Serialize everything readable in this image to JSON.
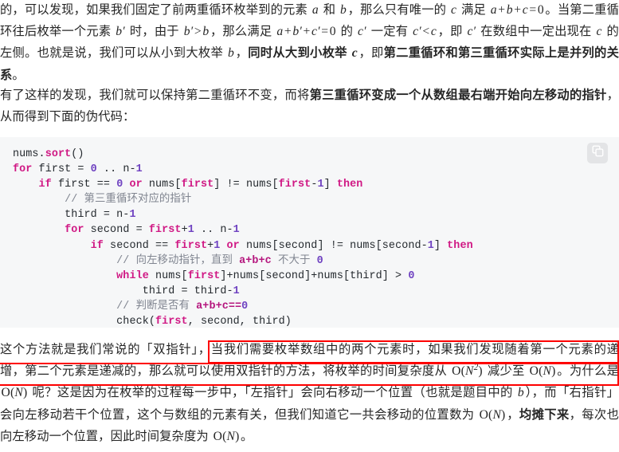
{
  "document": {
    "language": "zh-CN",
    "paragraph_1": {
      "text_runs": [
        {
          "type": "text",
          "value": "的，可以发现，如果我们固定了前两重循环枚举到的元素 "
        },
        {
          "type": "math",
          "value": "a"
        },
        {
          "type": "text",
          "value": " 和 "
        },
        {
          "type": "math",
          "value": "b"
        },
        {
          "type": "text",
          "value": "，那么只有唯一的 "
        },
        {
          "type": "math",
          "value": "c"
        },
        {
          "type": "text",
          "value": " 满足 "
        },
        {
          "type": "math",
          "value": "a + b + c = 0"
        },
        {
          "type": "text",
          "value": "。当第二重循环往后枚举一个元素 "
        },
        {
          "type": "math",
          "value": "b′"
        },
        {
          "type": "text",
          "value": " 时，由于 "
        },
        {
          "type": "math",
          "value": "b′ > b"
        },
        {
          "type": "text",
          "value": "，那么满足 "
        },
        {
          "type": "math",
          "value": "a + b′ + c′ = 0"
        },
        {
          "type": "text",
          "value": " 的 "
        },
        {
          "type": "math",
          "value": "c′"
        },
        {
          "type": "text",
          "value": " 一定有 "
        },
        {
          "type": "math",
          "value": "c′ < c"
        },
        {
          "type": "text",
          "value": "，即 "
        },
        {
          "type": "math",
          "value": "c′"
        },
        {
          "type": "text",
          "value": " 在数组中一定出现在 "
        },
        {
          "type": "math",
          "value": "c"
        },
        {
          "type": "text",
          "value": " 的左侧。也就是说，我们可以从小到大枚举 "
        },
        {
          "type": "math",
          "value": "b"
        },
        {
          "type": "text",
          "value": "，"
        },
        {
          "type": "bold",
          "value": "同时从大到小枚举 "
        },
        {
          "type": "bold-math",
          "value": "c"
        },
        {
          "type": "text",
          "value": "，即"
        },
        {
          "type": "bold",
          "value": "第二重循环和第三重循环实际上是并列的关系"
        },
        {
          "type": "text",
          "value": "。"
        }
      ]
    },
    "paragraph_2": {
      "text_runs": [
        {
          "type": "text",
          "value": "有了这样的发现，我们就可以保持第二重循环不变，而将"
        },
        {
          "type": "bold",
          "value": "第三重循环变成一个从数组最右端开始向左移动的指针"
        },
        {
          "type": "text",
          "value": "，从而得到下面的伪代码："
        }
      ]
    },
    "paragraph_3": {
      "text_runs": [
        {
          "type": "text",
          "value": "这个方法就是我们常说的「双指针」，当我们需要枚举数组中的两个元素时，如果我们发现随着第一个元素的递增，第二个元素是递减的，那么就可以使用双指针的方法，将枚举的时间复杂度从 "
        },
        {
          "type": "math",
          "value": "O(N²)"
        },
        {
          "type": "text",
          "value": " 减少至 "
        },
        {
          "type": "math",
          "value": "O(N)"
        },
        {
          "type": "text",
          "value": "。为什么是 "
        },
        {
          "type": "math",
          "value": "O(N)"
        },
        {
          "type": "text",
          "value": " 呢？这是因为在枚举的过程每一步中，「左指针」会向右移动一个位置（也就是题目中的 "
        },
        {
          "type": "math",
          "value": "b"
        },
        {
          "type": "text",
          "value": "），而「右指针」会向左移动若干个位置，这个与数组的元素有关，但我们知道它一共会移动的位置数为 "
        },
        {
          "type": "math",
          "value": "O(N)"
        },
        {
          "type": "text",
          "value": "，"
        },
        {
          "type": "bold",
          "value": "均摊下来"
        },
        {
          "type": "text",
          "value": "，每次也向左移动一个位置，因此时间复杂度为 "
        },
        {
          "type": "math",
          "value": "O(N)"
        },
        {
          "type": "text",
          "value": "。"
        }
      ]
    }
  },
  "code_block": {
    "language": "pseudocode",
    "copy_button": {
      "icon": "copy-icon",
      "label": ""
    },
    "lines": [
      [
        {
          "t": "pl",
          "v": "nums."
        },
        {
          "t": "id",
          "v": "sort"
        },
        {
          "t": "pl",
          "v": "()"
        }
      ],
      [
        {
          "t": "kw",
          "v": "for"
        },
        {
          "t": "pl",
          "v": " first = "
        },
        {
          "t": "num",
          "v": "0"
        },
        {
          "t": "pl",
          "v": " .. n-"
        },
        {
          "t": "num",
          "v": "1"
        }
      ],
      [
        {
          "t": "pl",
          "v": "    "
        },
        {
          "t": "kw",
          "v": "if"
        },
        {
          "t": "pl",
          "v": " first == "
        },
        {
          "t": "num",
          "v": "0"
        },
        {
          "t": "pl",
          "v": " "
        },
        {
          "t": "kw",
          "v": "or"
        },
        {
          "t": "pl",
          "v": " nums["
        },
        {
          "t": "id",
          "v": "first"
        },
        {
          "t": "pl",
          "v": "] != nums["
        },
        {
          "t": "id",
          "v": "first"
        },
        {
          "t": "pl",
          "v": "-"
        },
        {
          "t": "num",
          "v": "1"
        },
        {
          "t": "pl",
          "v": "] "
        },
        {
          "t": "kw",
          "v": "then"
        }
      ],
      [
        {
          "t": "pl",
          "v": "        "
        },
        {
          "t": "cmt",
          "v": "// 第三重循环对应的指针"
        }
      ],
      [
        {
          "t": "pl",
          "v": "        third = n-"
        },
        {
          "t": "num",
          "v": "1"
        }
      ],
      [
        {
          "t": "pl",
          "v": "        "
        },
        {
          "t": "kw",
          "v": "for"
        },
        {
          "t": "pl",
          "v": " second = "
        },
        {
          "t": "id",
          "v": "first"
        },
        {
          "t": "pl",
          "v": "+"
        },
        {
          "t": "num",
          "v": "1"
        },
        {
          "t": "pl",
          "v": " .. n-"
        },
        {
          "t": "num",
          "v": "1"
        }
      ],
      [
        {
          "t": "pl",
          "v": "            "
        },
        {
          "t": "kw",
          "v": "if"
        },
        {
          "t": "pl",
          "v": " second == "
        },
        {
          "t": "id",
          "v": "first"
        },
        {
          "t": "pl",
          "v": "+"
        },
        {
          "t": "num",
          "v": "1"
        },
        {
          "t": "pl",
          "v": " "
        },
        {
          "t": "kw",
          "v": "or"
        },
        {
          "t": "pl",
          "v": " nums[second] != nums[second-"
        },
        {
          "t": "num",
          "v": "1"
        },
        {
          "t": "pl",
          "v": "] "
        },
        {
          "t": "kw",
          "v": "then"
        }
      ],
      [
        {
          "t": "pl",
          "v": "                "
        },
        {
          "t": "cmt",
          "v": "// 向左移动指针，直到 "
        },
        {
          "t": "cmtb",
          "v": "a+b+c"
        },
        {
          "t": "cmt",
          "v": " 不大于 "
        },
        {
          "t": "num",
          "v": "0"
        }
      ],
      [
        {
          "t": "pl",
          "v": "                "
        },
        {
          "t": "kw",
          "v": "while"
        },
        {
          "t": "pl",
          "v": " nums["
        },
        {
          "t": "id",
          "v": "first"
        },
        {
          "t": "pl",
          "v": "]+nums[second]+nums[third] > "
        },
        {
          "t": "num",
          "v": "0"
        }
      ],
      [
        {
          "t": "pl",
          "v": "                    third = third-"
        },
        {
          "t": "num",
          "v": "1"
        }
      ],
      [
        {
          "t": "pl",
          "v": "                "
        },
        {
          "t": "cmt",
          "v": "// 判断是否有 "
        },
        {
          "t": "cmtb",
          "v": "a+b+c=="
        },
        {
          "t": "num",
          "v": "0"
        }
      ],
      [
        {
          "t": "pl",
          "v": "                check("
        },
        {
          "t": "id",
          "v": "first"
        },
        {
          "t": "pl",
          "v": ", second, third)"
        }
      ]
    ]
  },
  "annotations": {
    "color": "#fe0000",
    "boxes": [
      {
        "name": "annotation-box-line1",
        "covers_text": "当我们需要枚举数组中的两个元素时，如果我们发现随着第一个元素"
      },
      {
        "name": "annotation-box-line2",
        "covers_text": "的递增，第二个元素是递减的，那么就可以使用双指针的方法，将枚举的时间复杂度从 O(N²) 减少至 O(N)"
      }
    ]
  }
}
